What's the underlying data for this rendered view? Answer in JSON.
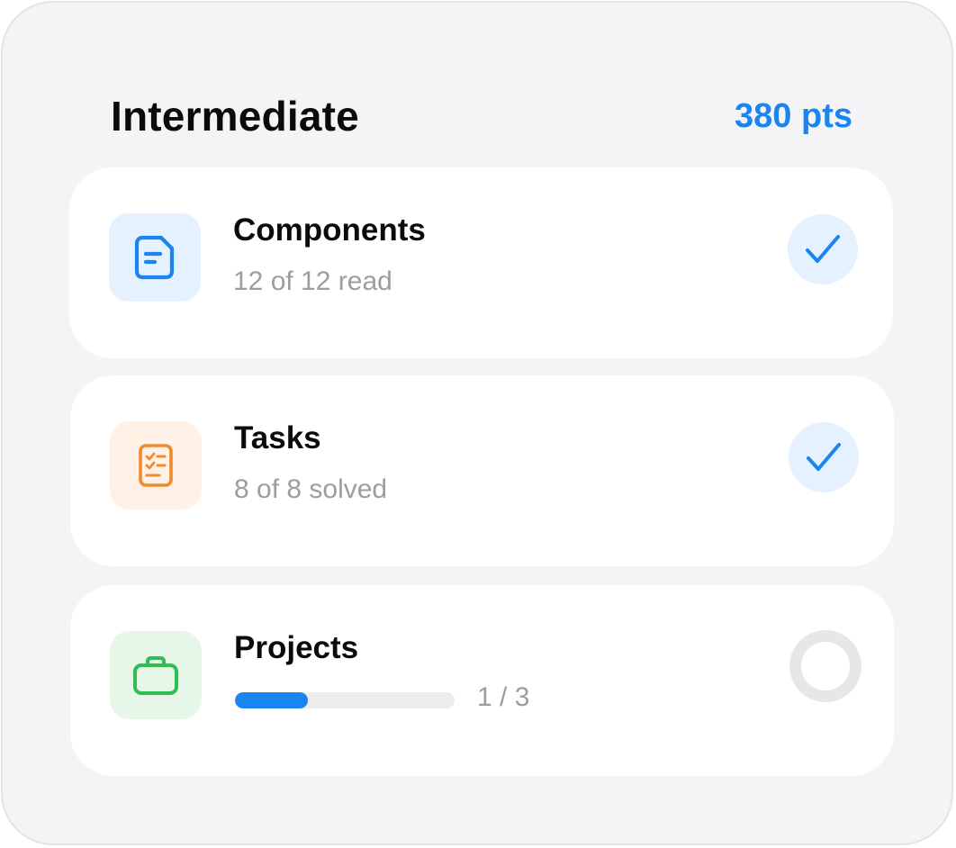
{
  "header": {
    "title": "Intermediate",
    "points": "380 pts"
  },
  "colors": {
    "accent": "#1a84f0",
    "components_tile": "#e5f1fe",
    "tasks_tile": "#fff1e6",
    "projects_tile": "#e6f7ea",
    "tasks_icon": "#f28a2e",
    "projects_icon": "#2fbe4f"
  },
  "items": [
    {
      "title": "Components",
      "subtitle": "12 of 12 read",
      "icon": "document-icon",
      "status": "completed",
      "status_icon": "checkmark-icon"
    },
    {
      "title": "Tasks",
      "subtitle": "8 of 8 solved",
      "icon": "checklist-icon",
      "status": "completed",
      "status_icon": "checkmark-icon"
    },
    {
      "title": "Projects",
      "progress": {
        "current": 1,
        "total": 3,
        "fraction": 0.33,
        "label": "1 / 3"
      },
      "icon": "briefcase-icon",
      "status": "in-progress",
      "status_icon": "empty-circle-icon"
    }
  ]
}
